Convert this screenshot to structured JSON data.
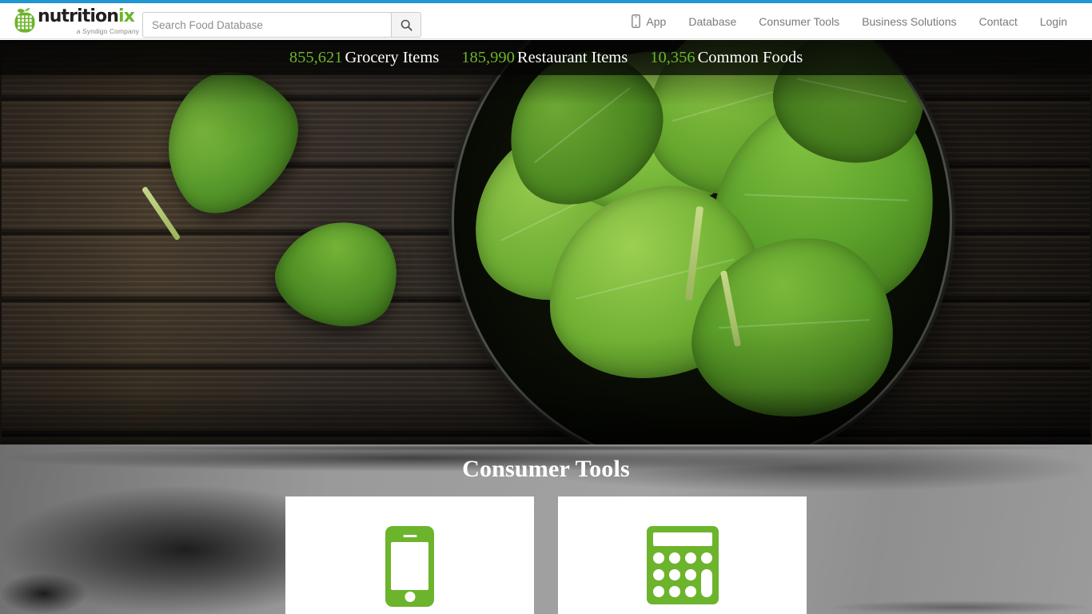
{
  "theme": {
    "accent_blue": "#2196d3",
    "brand_green": "#6cb42c",
    "logo_text_color": "#231f20",
    "nav_text_color": "#7a7a7a",
    "card_background": "#ffffff"
  },
  "header": {
    "logo": {
      "icon": "apple-grid-icon",
      "word_main": "nutrition",
      "word_accent": "ix",
      "tagline": "a Syndigo Company"
    },
    "search": {
      "placeholder": "Search Food Database",
      "value": "",
      "button_icon": "search-icon"
    },
    "nav": [
      {
        "label": "App",
        "icon": "mobile-phone-icon"
      },
      {
        "label": "Database",
        "icon": null
      },
      {
        "label": "Consumer Tools",
        "icon": null
      },
      {
        "label": "Business Solutions",
        "icon": null
      },
      {
        "label": "Contact",
        "icon": null
      },
      {
        "label": "Login",
        "icon": null
      }
    ]
  },
  "hero": {
    "image_description": "Bowl of fresh spinach leaves on dark weathered wood",
    "stats": [
      {
        "number": "855,621",
        "label": "Grocery Items"
      },
      {
        "number": "185,990",
        "label": "Restaurant Items"
      },
      {
        "number": "10,356",
        "label": "Common Foods"
      }
    ]
  },
  "consumer_tools": {
    "title": "Consumer Tools",
    "cards": [
      {
        "icon": "mobile-phone-icon",
        "label": ""
      },
      {
        "icon": "calculator-icon",
        "label": ""
      }
    ]
  }
}
